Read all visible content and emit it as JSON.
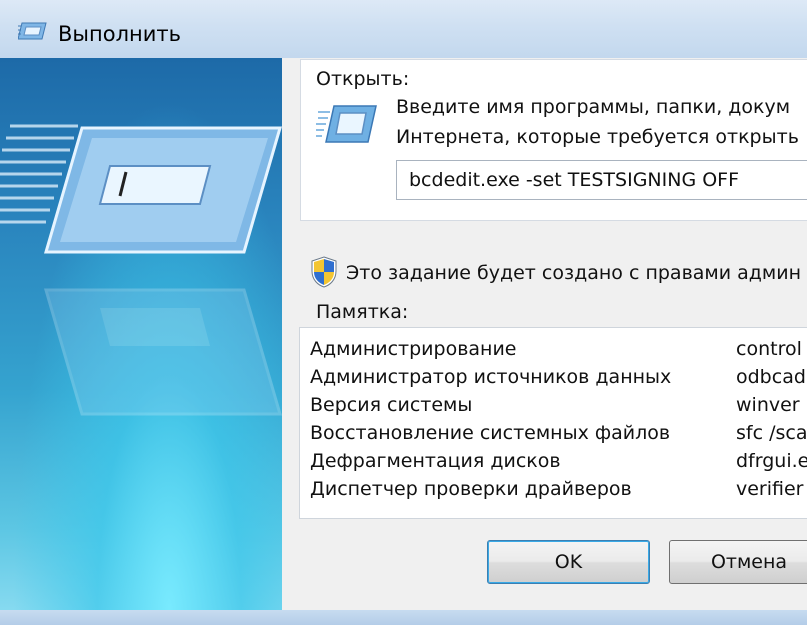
{
  "window": {
    "title": "Выполнить",
    "icon": "run-icon"
  },
  "open_group": {
    "label": "Открыть:",
    "description_line1": "Введите имя программы, папки, докум",
    "description_line2": "Интернета, которые требуется открыть",
    "command_value": "bcdedit.exe -set TESTSIGNING OFF",
    "icon": "run-icon"
  },
  "admin_notice": {
    "icon": "uac-shield-icon",
    "text": "Это задание будет создано с правами админ"
  },
  "memo": {
    "label": "Памятка:",
    "rows": [
      {
        "name": "Администрирование",
        "cmd": "control"
      },
      {
        "name": "Администратор источников данных",
        "cmd": "odbcad"
      },
      {
        "name": "Версия системы",
        "cmd": "winver"
      },
      {
        "name": "Восстановление системных файлов",
        "cmd": "sfc /sca"
      },
      {
        "name": "Дефрагментация дисков",
        "cmd": "dfrgui.e"
      },
      {
        "name": "Диспетчер проверки драйверов",
        "cmd": "verifier"
      }
    ]
  },
  "buttons": {
    "ok": "OK",
    "cancel": "Отмена"
  },
  "colors": {
    "accent": "#39a9e6",
    "panel_dark": "#1d6aa8",
    "panel_light": "#86daf0"
  }
}
